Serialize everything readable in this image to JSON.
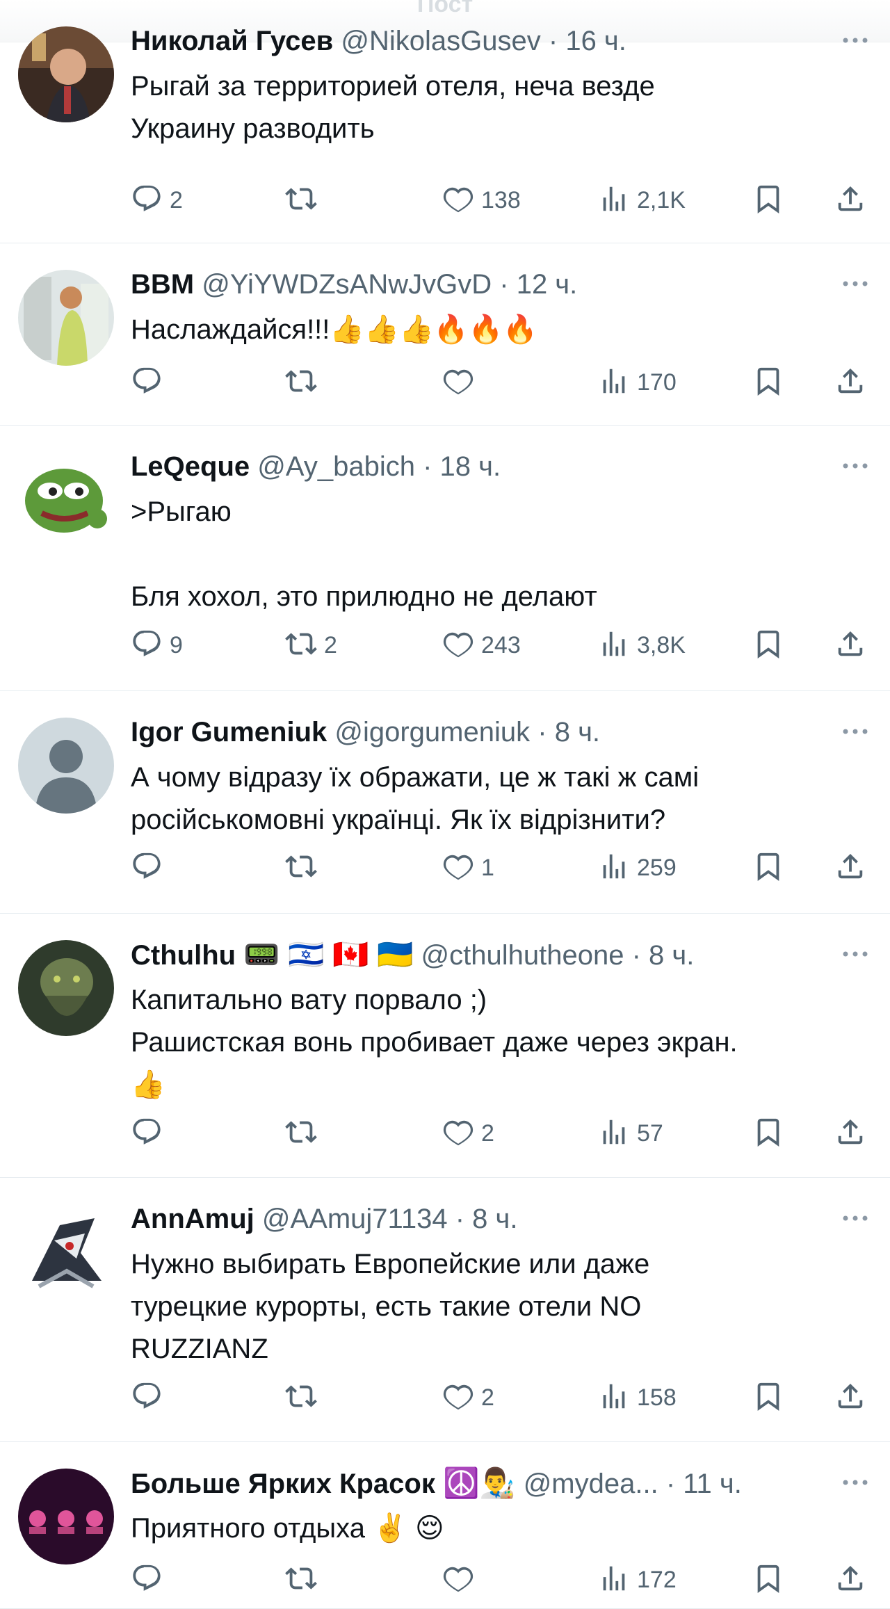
{
  "header": {
    "title": "Пост"
  },
  "tweets": [
    {
      "name": "Николай Гусев",
      "handle": "@NikolasGusev",
      "time": "16 ч.",
      "text": "Рыгай за территорией отеля, неча везде\nУкраину разводить",
      "replies": "2",
      "retweets": "",
      "likes": "138",
      "views": "2,1K"
    },
    {
      "name": "BBM",
      "handle": "@YiYWDZsANwJvGvD",
      "time": "12 ч.",
      "text": "Наслаждайся!!!👍👍👍🔥🔥🔥",
      "replies": "",
      "retweets": "",
      "likes": "",
      "views": "170"
    },
    {
      "name": "LeQeque",
      "handle": "@Ay_babich",
      "time": "18 ч.",
      "text": ">Рыгаю\n\nБля хохол, это прилюдно не делают",
      "replies": "9",
      "retweets": "2",
      "likes": "243",
      "views": "3,8K"
    },
    {
      "name": "Igor Gumeniuk",
      "handle": "@igorgumeniuk",
      "time": "8 ч.",
      "text": "А чому відразу їх ображати, це ж такі ж самі\nросійськомовні українці. Як їх відрізнити?",
      "replies": "",
      "retweets": "",
      "likes": "1",
      "views": "259"
    },
    {
      "name": "Cthulhu",
      "name_emoji": "📟 🇮🇱 🇨🇦 🇺🇦",
      "handle": "@cthulhutheone",
      "time": "8 ч.",
      "text": "Капитально вату порвало ;)\nРашистская вонь пробивает даже через экран.\n👍",
      "replies": "",
      "retweets": "",
      "likes": "2",
      "views": "57"
    },
    {
      "name": "AnnAmuj",
      "handle": "@AAmuj71134",
      "time": "8 ч.",
      "text": "Нужно выбирать Европейские или даже\nтурецкие курорты, есть такие отели NO\nRUZZIANZ",
      "replies": "",
      "retweets": "",
      "likes": "2",
      "views": "158"
    },
    {
      "name": "Больше Ярких Красок",
      "name_emoji": "☮️👨‍🎨",
      "handle": "@mydea...",
      "time": "11 ч.",
      "text": "Приятного отдыха ✌️ 😌",
      "replies": "",
      "retweets": "",
      "likes": "",
      "views": "172"
    }
  ],
  "icons": {
    "reply": "reply-icon",
    "retweet": "retweet-icon",
    "like": "heart-icon",
    "views": "views-icon",
    "bookmark": "bookmark-icon",
    "share": "share-icon",
    "more": "more-icon"
  },
  "colors": {
    "text": "#0f1419",
    "secondary": "#536471",
    "divider": "#e6ecf0"
  }
}
